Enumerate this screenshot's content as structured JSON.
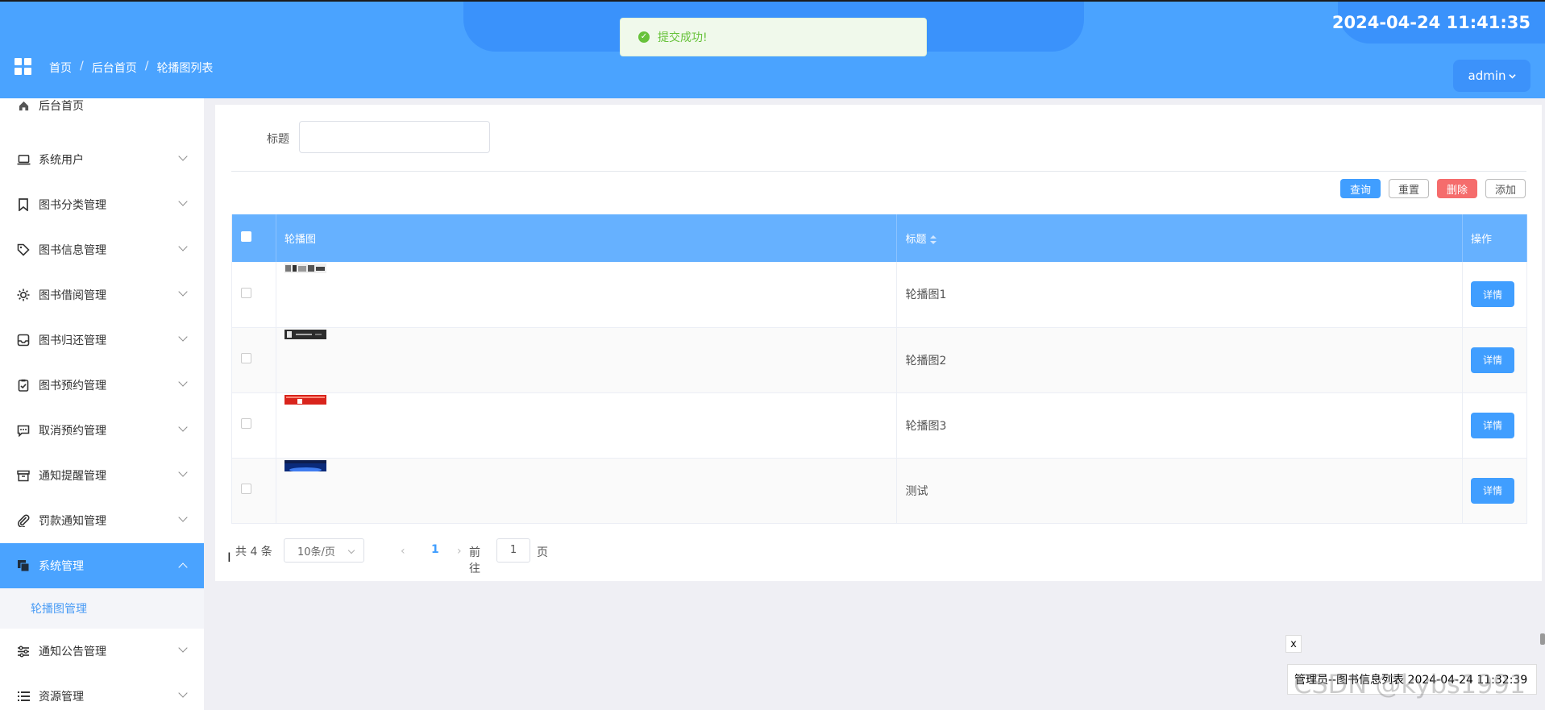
{
  "header": {
    "clock": "2024-04-24 11:41:35",
    "breadcrumb": [
      "首页",
      "后台首页",
      "轮播图列表"
    ],
    "breadcrumb_sep": "/",
    "user": "admin",
    "apps_icon": "apps-grid-icon"
  },
  "toast": {
    "message": "提交成功!",
    "icon": "success-check-icon",
    "color": "#67c23a"
  },
  "sidebar": {
    "items": [
      {
        "label": "后台首页",
        "icon": "home-icon"
      },
      {
        "label": "系统用户",
        "icon": "laptop-icon"
      },
      {
        "label": "图书分类管理",
        "icon": "bookmark-icon"
      },
      {
        "label": "图书信息管理",
        "icon": "tag-icon"
      },
      {
        "label": "图书借阅管理",
        "icon": "sun-icon"
      },
      {
        "label": "图书归还管理",
        "icon": "inbox-icon"
      },
      {
        "label": "图书预约管理",
        "icon": "clipboard-check-icon"
      },
      {
        "label": "取消预约管理",
        "icon": "message-icon"
      },
      {
        "label": "通知提醒管理",
        "icon": "archive-icon"
      },
      {
        "label": "罚款通知管理",
        "icon": "paperclip-icon"
      },
      {
        "label": "系统管理",
        "icon": "copy-icon",
        "active": true
      },
      {
        "label": "通知公告管理",
        "icon": "sliders-icon"
      },
      {
        "label": "资源管理",
        "icon": "list-icon"
      }
    ],
    "submenu_item": "轮播图管理",
    "accent": "#4aa3ff"
  },
  "filter": {
    "title_label": "标题",
    "title_value": ""
  },
  "toolbar": {
    "query": "查询",
    "reset": "重置",
    "delete": "删除",
    "add": "添加"
  },
  "table": {
    "columns": [
      "轮播图",
      "标题",
      "操作"
    ],
    "rows": [
      {
        "title": "轮播图1",
        "action": "详情"
      },
      {
        "title": "轮播图2",
        "action": "详情"
      },
      {
        "title": "轮播图3",
        "action": "详情"
      },
      {
        "title": "测试",
        "action": "详情"
      }
    ]
  },
  "pagination": {
    "total": "共 4 条",
    "page_size": "10条/页",
    "current_page": "1",
    "goto_label": "前往",
    "goto_value": "1",
    "page_suffix": "页"
  },
  "notice": {
    "close": "x",
    "text": "管理员--图书信息列表 2024-04-24 11:32:39"
  },
  "watermark": "CSDN @kybs1991"
}
